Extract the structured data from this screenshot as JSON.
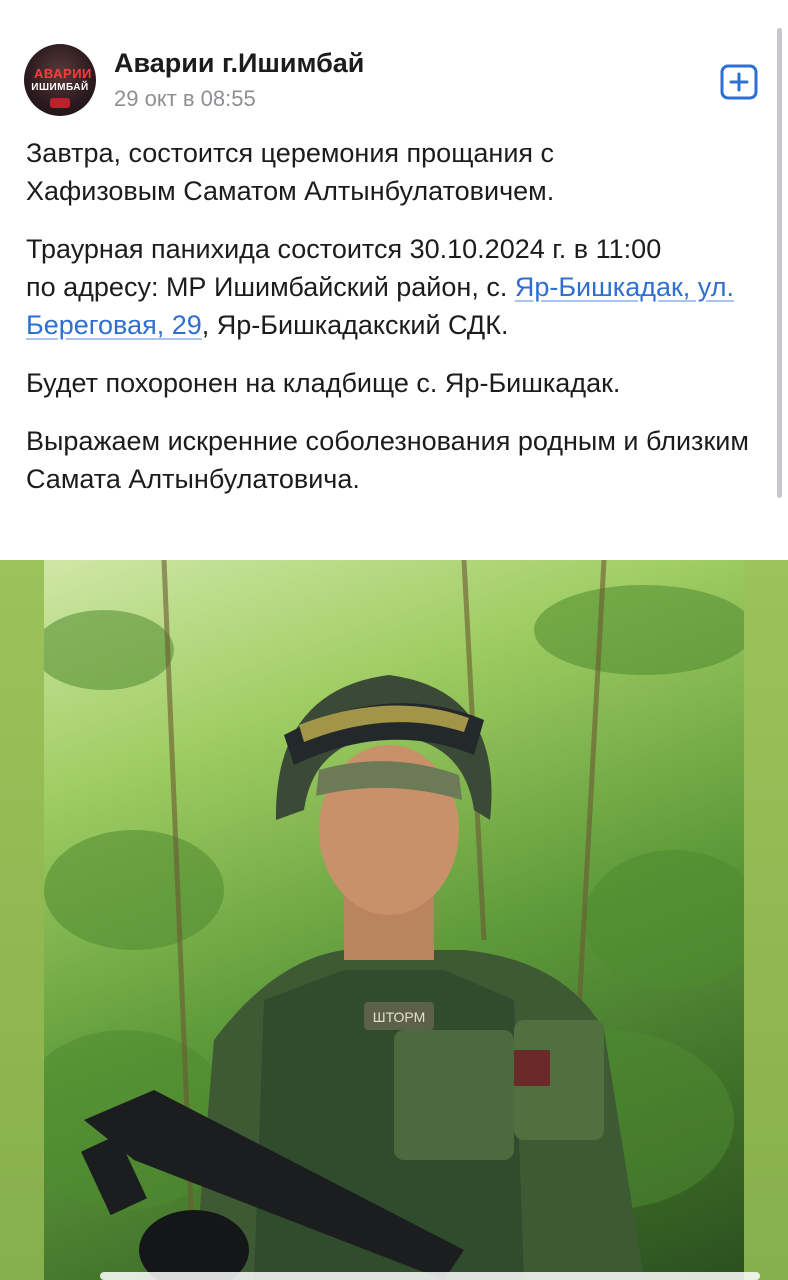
{
  "post": {
    "author": "Аварии г.Ишимбай",
    "avatar_text_1": "АВАРИИ",
    "avatar_text_2": "ИШИМБАЙ",
    "date": "29 окт в 08:55",
    "add_icon": "plus-square-icon",
    "paragraphs": {
      "p1_line1": "Завтра, состоится церемония прощания с",
      "p1_line2": " Хафизовым Саматом Алтынбулатовичем.",
      "p2_line1": "Траурная панихида состоится 30.10.2024 г. в 11:00",
      "p2_line2_prefix": "по адресу: МР Ишимбайский район, с. ",
      "p2_link": "Яр-Бишкадак, ул. Береговая, 29",
      "p2_suffix": ", Яр-Бишкадакский СДК.",
      "p3": "Будет похоронен на кладбище с. Яр-Бишкадак.",
      "p4": "Выражаем искренние соболезнования родным и близким Самата Алтынбулатовича."
    },
    "photo_label": "ШТОРМ"
  },
  "colors": {
    "link": "#2f6fd1",
    "accent": "#2f6fd1",
    "text": "#1c1c1e",
    "muted": "#8e8e93"
  }
}
